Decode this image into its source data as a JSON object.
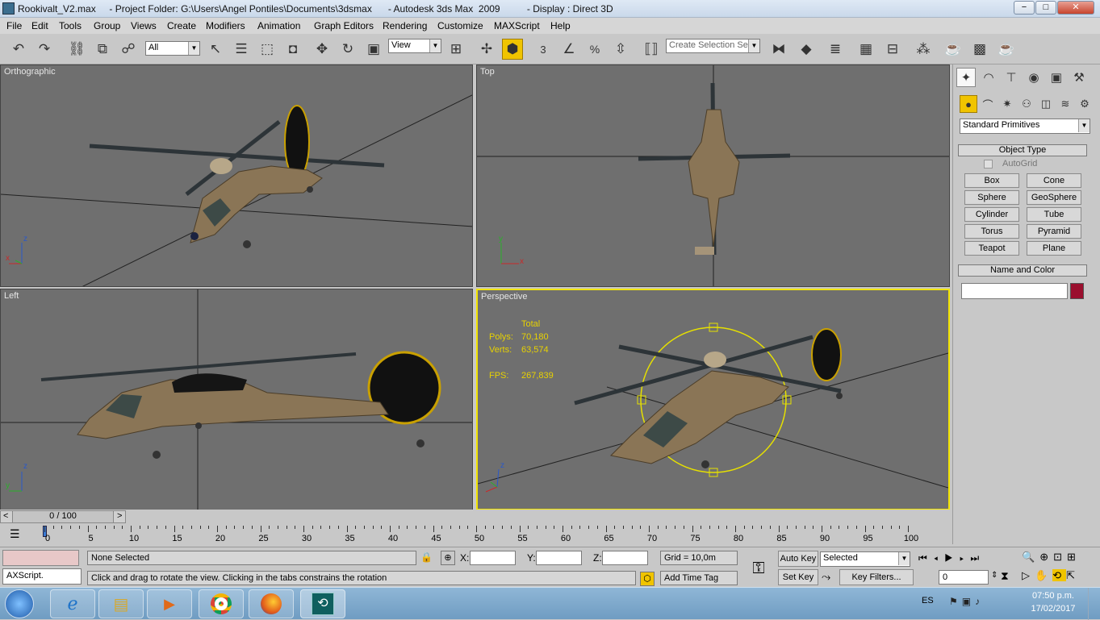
{
  "window": {
    "title": "Rookivalt_V2.max     - Project Folder: G:\\Users\\Angel Pontiles\\Documents\\3dsmax      - Autodesk 3ds Max  2009          - Display : Direct 3D",
    "minimize": "−",
    "maximize": "□",
    "close": "✕"
  },
  "menu": [
    "File",
    "Edit",
    "Tools",
    "Group",
    "Views",
    "Create",
    "Modifiers",
    "Animation",
    "Graph Editors",
    "Rendering",
    "Customize",
    "MAXScript",
    "Help"
  ],
  "toolbar": {
    "selection_filter": "All",
    "reference_coord": "View",
    "selection_set_placeholder": "Create Selection Set",
    "icons": [
      "undo-icon",
      "redo-icon",
      "select-link-icon",
      "unlink-icon",
      "bind-space-warp-icon",
      "select-object-icon",
      "select-by-name-icon",
      "rect-region-icon",
      "window-crossing-icon",
      "move-icon",
      "rotate-icon",
      "scale-icon",
      "pivot-icon",
      "manipulate-icon",
      "snap-3d-icon",
      "angle-snap-icon",
      "percent-snap-icon",
      "spinner-snap-icon",
      "named-selection-icon",
      "mirror-icon",
      "align-icon",
      "layer-manager-icon",
      "curve-editor-icon",
      "schematic-view-icon",
      "material-editor-icon",
      "render-setup-icon",
      "rendered-frame-icon",
      "quick-render-icon"
    ],
    "snap_label": "3",
    "percent_label": "%"
  },
  "viewports": {
    "orthographic": {
      "label": "Orthographic"
    },
    "top": {
      "label": "Top"
    },
    "left": {
      "label": "Left"
    },
    "perspective": {
      "label": "Perspective",
      "stats_header": "Total",
      "polys_label": "Polys:",
      "polys_value": "70,180",
      "verts_label": "Verts:",
      "verts_value": "63,574",
      "fps_label": "FPS:",
      "fps_value": "267,839"
    },
    "axis": {
      "x": "x",
      "y": "y",
      "z": "z"
    }
  },
  "command_panel": {
    "tabs": [
      "create-tab",
      "modify-tab",
      "hierarchy-tab",
      "motion-tab",
      "display-tab",
      "utilities-tab"
    ],
    "subtabs": [
      "geometry-icon",
      "shapes-icon",
      "lights-icon",
      "cameras-icon",
      "helpers-icon",
      "space-warps-icon",
      "systems-icon"
    ],
    "category": "Standard Primitives",
    "object_type_header": "Object Type",
    "autogrid": "AutoGrid",
    "objects": [
      "Box",
      "Cone",
      "Sphere",
      "GeoSphere",
      "Cylinder",
      "Tube",
      "Torus",
      "Pyramid",
      "Teapot",
      "Plane"
    ],
    "name_color_header": "Name and Color",
    "object_name": "",
    "object_color": "#9a0f2e"
  },
  "timeline": {
    "frame_display": "0 / 100",
    "prev": "<",
    "next": ">",
    "ticks": [
      "0",
      "5",
      "10",
      "15",
      "20",
      "25",
      "30",
      "35",
      "40",
      "45",
      "50",
      "55",
      "60",
      "65",
      "70",
      "75",
      "80",
      "85",
      "90",
      "95",
      "100"
    ]
  },
  "status": {
    "selection": "None Selected",
    "maxscript": "AXScript.",
    "prompt": "Click and drag to rotate the view.  Clicking in the tabs constrains the rotation",
    "x_label": "X:",
    "y_label": "Y:",
    "z_label": "Z:",
    "x_value": "",
    "y_value": "",
    "z_value": "",
    "grid": "Grid = 10,0m",
    "add_time_tag": "Add Time Tag",
    "auto_key": "Auto Key",
    "set_key": "Set Key",
    "key_mode": "Selected",
    "key_filters": "Key Filters...",
    "current_frame": "0"
  },
  "taskbar": {
    "apps": [
      "start-orb-icon",
      "internet-explorer-icon",
      "file-explorer-icon",
      "media-player-icon",
      "chrome-icon",
      "firefox-icon",
      "3dsmax-icon"
    ],
    "lang": "ES",
    "time": "07:50 p.m.",
    "date": "17/02/2017"
  }
}
